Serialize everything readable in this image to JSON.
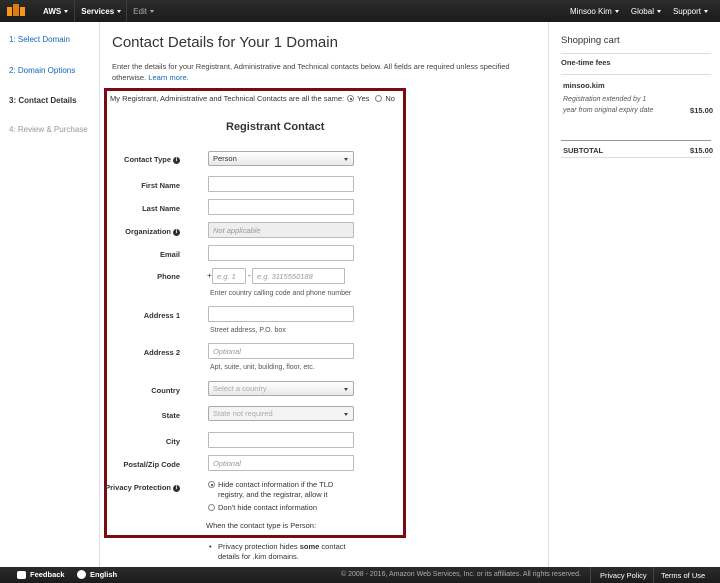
{
  "topnav": {
    "brand": "AWS",
    "services": "Services",
    "edit": "Edit",
    "user": "Minsoo Kim",
    "region": "Global",
    "support": "Support"
  },
  "steps": [
    {
      "label": "1: Select Domain"
    },
    {
      "label": "2: Domain Options"
    },
    {
      "label": "3: Contact Details"
    },
    {
      "label": "4: Review & Purchase"
    }
  ],
  "main": {
    "title": "Contact Details for Your 1 Domain",
    "intro": "Enter the details for your Registrant, Administrative and Technical contacts below. All fields are required unless specified otherwise.",
    "learn_more": "Learn more.",
    "same_question": "My Registrant, Administrative and Technical Contacts are all the same:",
    "yes": "Yes",
    "no": "No",
    "section_title": "Registrant Contact"
  },
  "form": {
    "contact_type": {
      "label": "Contact Type",
      "value": "Person"
    },
    "first_name": {
      "label": "First Name",
      "value": ""
    },
    "last_name": {
      "label": "Last Name",
      "value": ""
    },
    "organization": {
      "label": "Organization",
      "placeholder": "Not applicable"
    },
    "email": {
      "label": "Email",
      "value": ""
    },
    "phone": {
      "label": "Phone",
      "plus": "+",
      "dash": "-",
      "code_placeholder": "e.g. 1",
      "number_placeholder": "e.g. 3115550188",
      "hint": "Enter country calling code and phone number"
    },
    "address1": {
      "label": "Address 1",
      "hint": "Street address, P.O. box"
    },
    "address2": {
      "label": "Address 2",
      "placeholder": "Optional",
      "hint": "Apt, suite, unit, building, floor, etc."
    },
    "country": {
      "label": "Country",
      "placeholder": "Select a country"
    },
    "state": {
      "label": "State",
      "placeholder": "State not required"
    },
    "city": {
      "label": "City",
      "value": ""
    },
    "postal": {
      "label": "Postal/Zip Code",
      "placeholder": "Optional"
    },
    "privacy": {
      "label": "Privacy Protection",
      "option_hide": "Hide contact information if the TLD registry, and the registrar, allow it",
      "option_show": "Don't hide contact information",
      "note": "When the contact type is Person:",
      "bullet_pre": "Privacy protection hides ",
      "bullet_bold": "some",
      "bullet_post": " contact details for .kim domains."
    }
  },
  "cart": {
    "title": "Shopping cart",
    "fees": "One-time fees",
    "user": "minsoo.kim",
    "desc": "Registration extended by 1 year from original expiry date",
    "price": "$15.00",
    "subtotal_label": "SUBTOTAL",
    "subtotal": "$15.00"
  },
  "footer": {
    "feedback": "Feedback",
    "language": "English",
    "copyright": "© 2008 - 2016, Amazon Web Services, Inc. or its affiliates. All rights reserved.",
    "privacy": "Privacy Policy",
    "terms": "Terms of Use"
  },
  "colors": {
    "highlight_border": "#7b0a12",
    "link": "#1166bb",
    "nav_bg": "#1b1b1b",
    "logo": "#f7981d"
  }
}
